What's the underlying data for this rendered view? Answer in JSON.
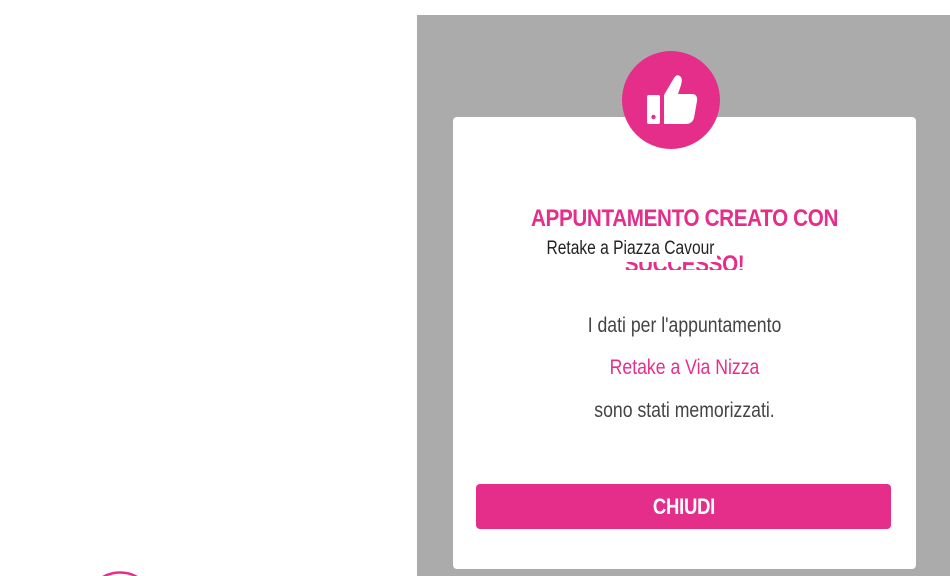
{
  "colors": {
    "accent": "#e52e8a",
    "overlay": "#ababab",
    "modal_background": "#ffffff",
    "body_text": "#444444"
  },
  "brand": {
    "logo_icon": "brand-outline-icon"
  },
  "dialog": {
    "icon": "thumbs-up-icon",
    "title_line1": "APPUNTAMENTO CREATO CON",
    "title_line2": "SUCCESSO!",
    "message_line1": "I dati per l'appuntamento",
    "appointment_name": "Retake a Via Nizza",
    "message_line3": "sono stati memorizzati.",
    "close_label": "CHIUDI"
  },
  "tooltip": {
    "text": "Retake a Piazza Cavour"
  }
}
